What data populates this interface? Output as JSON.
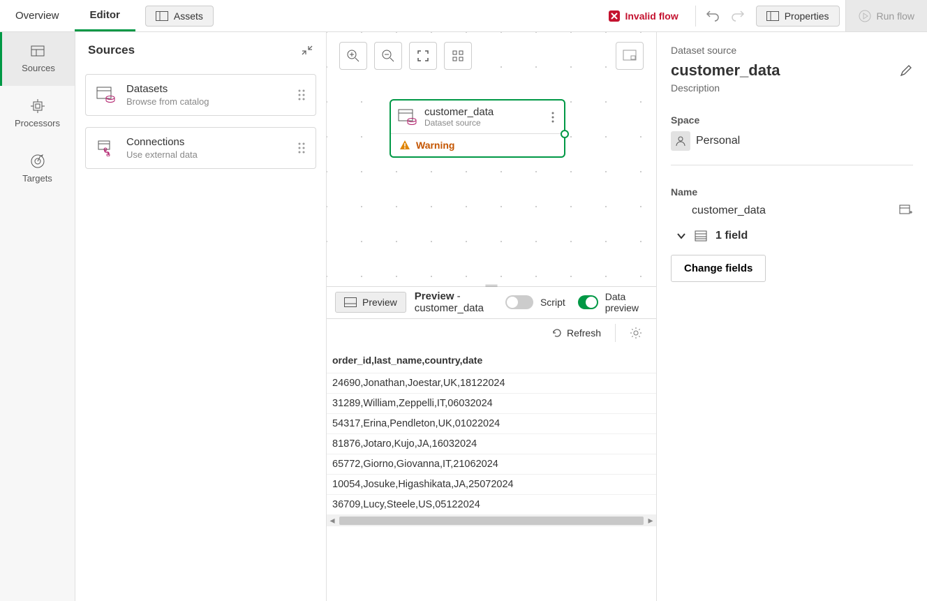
{
  "topbar": {
    "tabs": {
      "overview": "Overview",
      "editor": "Editor"
    },
    "assets": "Assets",
    "invalid": "Invalid flow",
    "properties": "Properties",
    "run": "Run flow"
  },
  "leftRail": {
    "sources": "Sources",
    "processors": "Processors",
    "targets": "Targets"
  },
  "sourcesPanel": {
    "title": "Sources",
    "cards": [
      {
        "title": "Datasets",
        "sub": "Browse from catalog"
      },
      {
        "title": "Connections",
        "sub": "Use external data"
      }
    ]
  },
  "node": {
    "title": "customer_data",
    "sub": "Dataset source",
    "warning": "Warning"
  },
  "previewBar": {
    "button": "Preview",
    "titlePrefix": "Preview",
    "titleSuffix": " - customer_data",
    "scriptLabel": "Script",
    "dataPreviewLabel": "Data preview"
  },
  "refreshRow": {
    "refresh": "Refresh"
  },
  "dataTable": {
    "header": "order_id,last_name,country,date",
    "rows": [
      "24690,Jonathan,Joestar,UK,18122024",
      "31289,William,Zeppelli,IT,06032024",
      "54317,Erina,Pendleton,UK,01022024",
      "81876,Jotaro,Kujo,JA,16032024",
      "65772,Giorno,Giovanna,IT,21062024",
      "10054,Josuke,Higashikata,JA,25072024",
      "36709,Lucy,Steele,US,05122024"
    ]
  },
  "rightPanel": {
    "kicker": "Dataset source",
    "title": "customer_data",
    "desc": "Description",
    "spaceLabel": "Space",
    "spaceValue": "Personal",
    "nameLabel": "Name",
    "nameValue": "customer_data",
    "fieldsLabel": "1 field",
    "changeFields": "Change fields"
  }
}
